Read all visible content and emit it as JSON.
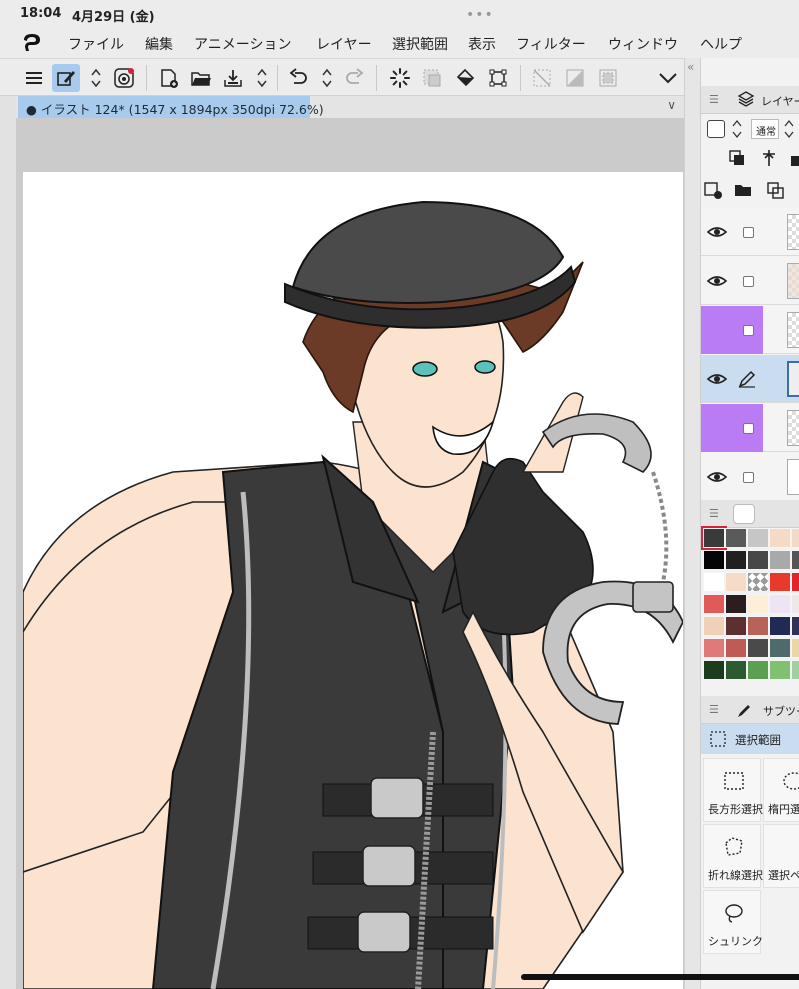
{
  "status_bar": {
    "time": "18:04",
    "date": "4月29日 (金)",
    "more": "•••"
  },
  "menu": {
    "items": [
      "ファイル",
      "編集",
      "アニメーション",
      "レイヤー",
      "選択範囲",
      "表示",
      "フィルター",
      "ウィンドウ",
      "ヘルプ"
    ]
  },
  "document": {
    "tab_title": "● イラスト 124* (1547 x 1894px 350dpi 72.6%)"
  },
  "right_panel": {
    "layer_tab_label": "レイヤー",
    "blend_mode": "通常",
    "subtool_tab_label": "サブツー",
    "selection_category": "選択範囲",
    "tools": [
      "長方形選択",
      "楕円選択",
      "折れ線選択",
      "選択ペン",
      "シュリンク"
    ]
  },
  "colors": {
    "accent_blue": "#a8cbed",
    "layer_purple": "#b97cf5",
    "swatches": [
      "#3a3a3a",
      "#5a5a5a",
      "#c6c6c6",
      "#f5dbc5",
      "#f2dac6",
      "#050505",
      "#202020",
      "#474747",
      "#a9a9a9",
      "#555555",
      "#ffffff",
      "#f6dcc8",
      "checker",
      "#e53a2c",
      "#e0242a",
      "#e05a5a",
      "#2a1e1e",
      "#fdeed8",
      "#efe4f4",
      "#f0e8e8",
      "#f1d0b8",
      "#5c3030",
      "#b8625a",
      "#202a55",
      "#30305a",
      "#e07a78",
      "#c05a56",
      "#4a4a4a",
      "#4f6a6a",
      "#e8d8a8",
      "#1b3d1d",
      "#2d5a30",
      "#5aa050",
      "#80c070",
      "#a0d0a0"
    ]
  }
}
